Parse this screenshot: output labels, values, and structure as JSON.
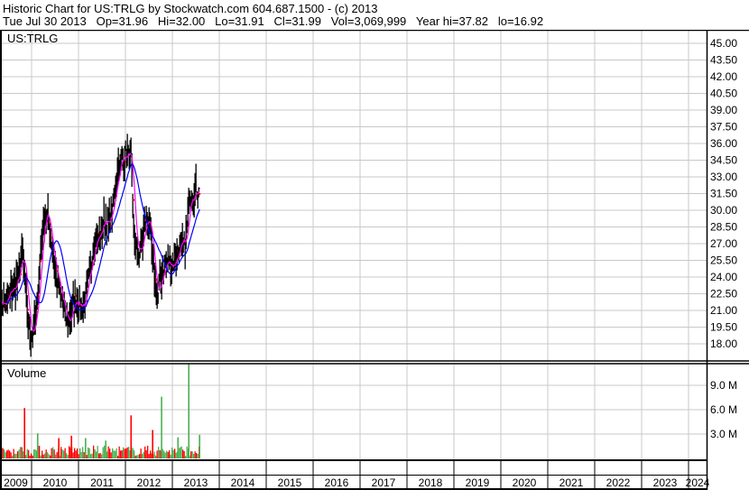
{
  "header": {
    "line1": "Historic Chart for US:TRLG by Stockwatch.com 604.687.1500 - (c) 2013",
    "line2": "Tue Jul 30 2013   Op=31.96   Hi=32.00   Lo=31.91   Cl=31.99   Vol=3,069,999   Year hi=37.82   lo=16.92"
  },
  "colors": {
    "bars": "#000000",
    "close_dot": "#ff0000",
    "ma_short": "#ff00ff",
    "ma_long": "#0000ff",
    "vol_up": "#4caf50",
    "vol_down": "#ff0000",
    "grid": "#c8c8c8"
  },
  "chart_data": {
    "type": "line",
    "title": "US:TRLG",
    "price_panel_label": "US:TRLG",
    "volume_panel_label": "Volume",
    "price_ylim": [
      16.5,
      46
    ],
    "price_ticks": [
      "45.00",
      "43.50",
      "42.00",
      "40.50",
      "39.00",
      "37.50",
      "36.00",
      "34.50",
      "33.00",
      "31.50",
      "30.00",
      "28.50",
      "27.00",
      "25.50",
      "24.00",
      "22.50",
      "21.00",
      "19.50",
      "18.00"
    ],
    "volume_ticks": [
      "9.0 M",
      "6.0 M",
      "3.0 M"
    ],
    "volume_tick_values_M": [
      9,
      6,
      3
    ],
    "x_ticks": [
      "2009",
      "2010",
      "2011",
      "2012",
      "2013",
      "2014",
      "2015",
      "2016",
      "2017",
      "2018",
      "2019",
      "2020",
      "2021",
      "2022",
      "2023",
      "2024"
    ],
    "grid": true,
    "price_series": [
      [
        2009.33,
        22.1
      ],
      [
        2009.42,
        21.3
      ],
      [
        2009.52,
        22.5
      ],
      [
        2009.62,
        23.0
      ],
      [
        2009.71,
        23.8
      ],
      [
        2009.81,
        26.2
      ],
      [
        2009.87,
        23.0
      ],
      [
        2009.94,
        19.7
      ],
      [
        2010.0,
        18.9
      ],
      [
        2010.1,
        20.5
      ],
      [
        2010.19,
        26.2
      ],
      [
        2010.29,
        30.2
      ],
      [
        2010.38,
        28.6
      ],
      [
        2010.48,
        25.4
      ],
      [
        2010.58,
        23.0
      ],
      [
        2010.67,
        21.3
      ],
      [
        2010.77,
        19.7
      ],
      [
        2010.87,
        21.3
      ],
      [
        2010.96,
        22.1
      ],
      [
        2011.06,
        21.3
      ],
      [
        2011.15,
        22.1
      ],
      [
        2011.25,
        24.6
      ],
      [
        2011.35,
        27.8
      ],
      [
        2011.44,
        27.4
      ],
      [
        2011.54,
        29.4
      ],
      [
        2011.63,
        28.6
      ],
      [
        2011.73,
        30.2
      ],
      [
        2011.83,
        33.5
      ],
      [
        2011.92,
        34.7
      ],
      [
        2012.02,
        35.1
      ],
      [
        2012.12,
        34.7
      ],
      [
        2012.17,
        28.6
      ],
      [
        2012.25,
        26.2
      ],
      [
        2012.35,
        26.6
      ],
      [
        2012.4,
        28.6
      ],
      [
        2012.5,
        29.4
      ],
      [
        2012.6,
        24.6
      ],
      [
        2012.69,
        22.1
      ],
      [
        2012.79,
        24.6
      ],
      [
        2012.88,
        25.4
      ],
      [
        2012.98,
        25.0
      ],
      [
        2013.08,
        25.8
      ],
      [
        2013.17,
        27.0
      ],
      [
        2013.27,
        26.6
      ],
      [
        2013.37,
        31.5
      ],
      [
        2013.46,
        31.7
      ],
      [
        2013.58,
        31.99
      ]
    ],
    "volume_spikes_M": [
      [
        2009.33,
        3.6,
        "up"
      ],
      [
        2009.85,
        6.2,
        "down"
      ],
      [
        2010.13,
        3.1,
        "up"
      ],
      [
        2010.58,
        2.5,
        "down"
      ],
      [
        2010.85,
        2.8,
        "down"
      ],
      [
        2011.15,
        2.5,
        "up"
      ],
      [
        2011.58,
        2.2,
        "up"
      ],
      [
        2012.12,
        5.3,
        "down"
      ],
      [
        2012.58,
        3.5,
        "down"
      ],
      [
        2012.77,
        7.6,
        "up"
      ],
      [
        2013.12,
        2.6,
        "up"
      ],
      [
        2013.35,
        11.6,
        "up"
      ],
      [
        2013.58,
        2.9,
        "up"
      ]
    ]
  }
}
